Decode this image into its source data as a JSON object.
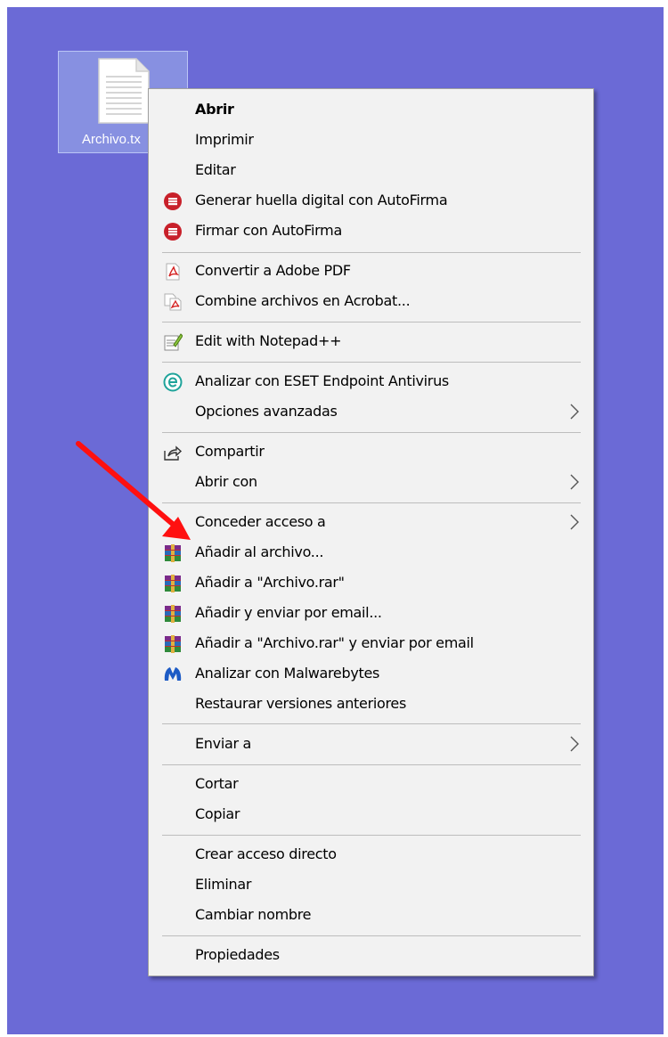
{
  "desktop": {
    "background": "#6b6ad6",
    "file": {
      "label": "Archivo.tx",
      "icon": "text-file-icon"
    }
  },
  "menu": {
    "items": [
      {
        "label": "Abrir",
        "bold": true
      },
      {
        "label": "Imprimir"
      },
      {
        "label": "Editar"
      },
      {
        "label": "Generar huella digital con AutoFirma",
        "icon": "autofirma-icon"
      },
      {
        "label": "Firmar con AutoFirma",
        "icon": "autofirma-icon"
      },
      {
        "label": "Convertir a Adobe PDF",
        "icon": "acrobat-pdf-icon"
      },
      {
        "label": "Combine archivos en Acrobat...",
        "icon": "acrobat-combine-icon"
      },
      {
        "label": "Edit with Notepad++",
        "icon": "notepad-plus-plus-icon"
      },
      {
        "label": "Analizar con ESET Endpoint Antivirus",
        "icon": "eset-icon"
      },
      {
        "label": "Opciones avanzadas",
        "submenu": true
      },
      {
        "label": "Compartir",
        "icon": "share-icon"
      },
      {
        "label": "Abrir con",
        "submenu": true
      },
      {
        "label": "Conceder acceso a",
        "submenu": true
      },
      {
        "label": "Añadir al archivo...",
        "icon": "winrar-icon"
      },
      {
        "label": "Añadir a \"Archivo.rar\"",
        "icon": "winrar-icon"
      },
      {
        "label": "Añadir y enviar por email...",
        "icon": "winrar-icon"
      },
      {
        "label": "Añadir a \"Archivo.rar\" y enviar por email",
        "icon": "winrar-icon"
      },
      {
        "label": "Analizar con Malwarebytes",
        "icon": "malwarebytes-icon"
      },
      {
        "label": "Restaurar versiones anteriores"
      },
      {
        "label": "Enviar a",
        "submenu": true
      },
      {
        "label": "Cortar"
      },
      {
        "label": "Copiar"
      },
      {
        "label": "Crear acceso directo"
      },
      {
        "label": "Eliminar"
      },
      {
        "label": "Cambiar nombre"
      },
      {
        "label": "Propiedades"
      }
    ]
  },
  "annotation": {
    "arrow_color": "#ff1010",
    "points_to": "Añadir al archivo..."
  }
}
